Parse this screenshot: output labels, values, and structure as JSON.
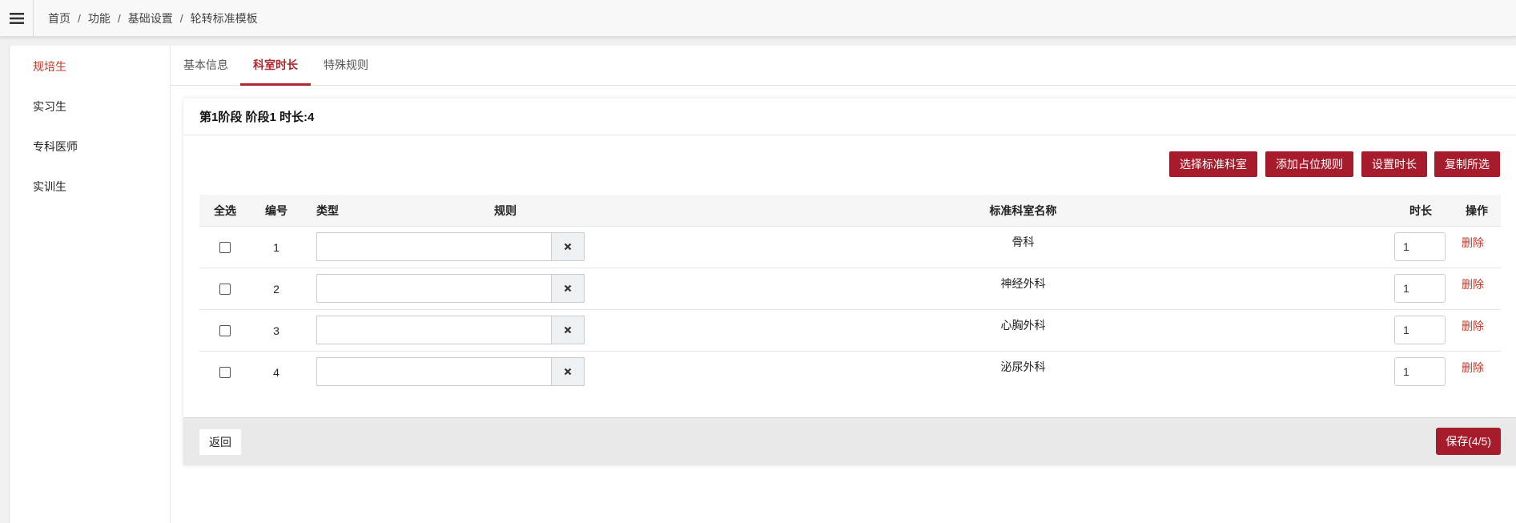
{
  "breadcrumb": [
    "首页",
    "功能",
    "基础设置",
    "轮转标准模板"
  ],
  "breadcrumb_separator": "/",
  "sidebar": {
    "items": [
      {
        "label": "规培生",
        "active": true
      },
      {
        "label": "实习生",
        "active": false
      },
      {
        "label": "专科医师",
        "active": false
      },
      {
        "label": "实训生",
        "active": false
      }
    ]
  },
  "tabs": [
    {
      "label": "基本信息",
      "active": false
    },
    {
      "label": "科室时长",
      "active": true
    },
    {
      "label": "特殊规则",
      "active": false
    }
  ],
  "panel": {
    "title": "第1阶段 阶段1 时长:4",
    "actions": {
      "select_dept": "选择标准科室",
      "add_rule": "添加占位规则",
      "set_duration": "设置时长",
      "copy_selected": "复制所选"
    },
    "columns": {
      "select_all": "全选",
      "number": "编号",
      "type": "类型",
      "rule": "规则",
      "dept_name": "标准科室名称",
      "duration": "时长",
      "operation": "操作"
    },
    "rows": [
      {
        "number": "1",
        "rule": "",
        "dept_name": "骨科",
        "duration": "1",
        "delete": "删除"
      },
      {
        "number": "2",
        "rule": "",
        "dept_name": "神经外科",
        "duration": "1",
        "delete": "删除"
      },
      {
        "number": "3",
        "rule": "",
        "dept_name": "心胸外科",
        "duration": "1",
        "delete": "删除"
      },
      {
        "number": "4",
        "rule": "",
        "dept_name": "泌尿外科",
        "duration": "1",
        "delete": "删除"
      }
    ],
    "footer": {
      "back": "返回",
      "save": "保存(4/5)"
    }
  },
  "colors": {
    "accent": "#a71c2c",
    "type_icon": "#2a7ab8"
  },
  "icons": {
    "menu": "hamburger-icon",
    "type": "cubes-icon",
    "clear": "times-icon"
  }
}
